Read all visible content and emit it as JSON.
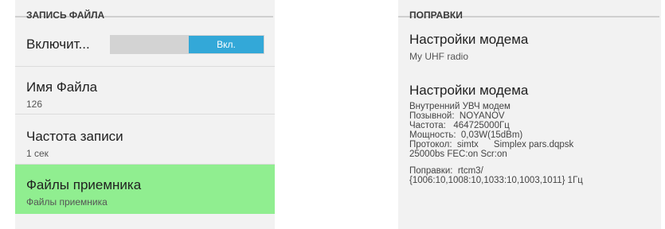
{
  "left": {
    "header": "ЗАПИСЬ ФАЙЛА",
    "enable": {
      "label": "Включит...",
      "toggle_on_label": "Вкл."
    },
    "filename": {
      "title": "Имя Файла",
      "value": "126"
    },
    "rate": {
      "title": "Частота записи",
      "value": "1 сек"
    },
    "receiver_files": {
      "title": "Файлы приемника",
      "value": "Файлы приемника"
    }
  },
  "right": {
    "header": "ПОПРАВКИ",
    "modem1": {
      "title": "Настройки модема",
      "value": "My UHF radio"
    },
    "modem2": {
      "title": "Настройки модема",
      "lines": [
        "Внутренний УВЧ модем",
        "Позывной:  NOYANOV",
        "Частота:   464725000Гц",
        "Мощность:  0,03W(15dBm)",
        "Протокол:  simtx      Simplex pars.dqpsk",
        "25000bs FEC:on Scr:on"
      ],
      "corrections_lines": [
        "Поправки:  rtcm3/",
        "{1006:10,1008:10,1033:10,1003,1011} 1Гц"
      ]
    }
  },
  "colors": {
    "toggle_accent": "#33a8d8",
    "highlight": "#90ee90"
  }
}
